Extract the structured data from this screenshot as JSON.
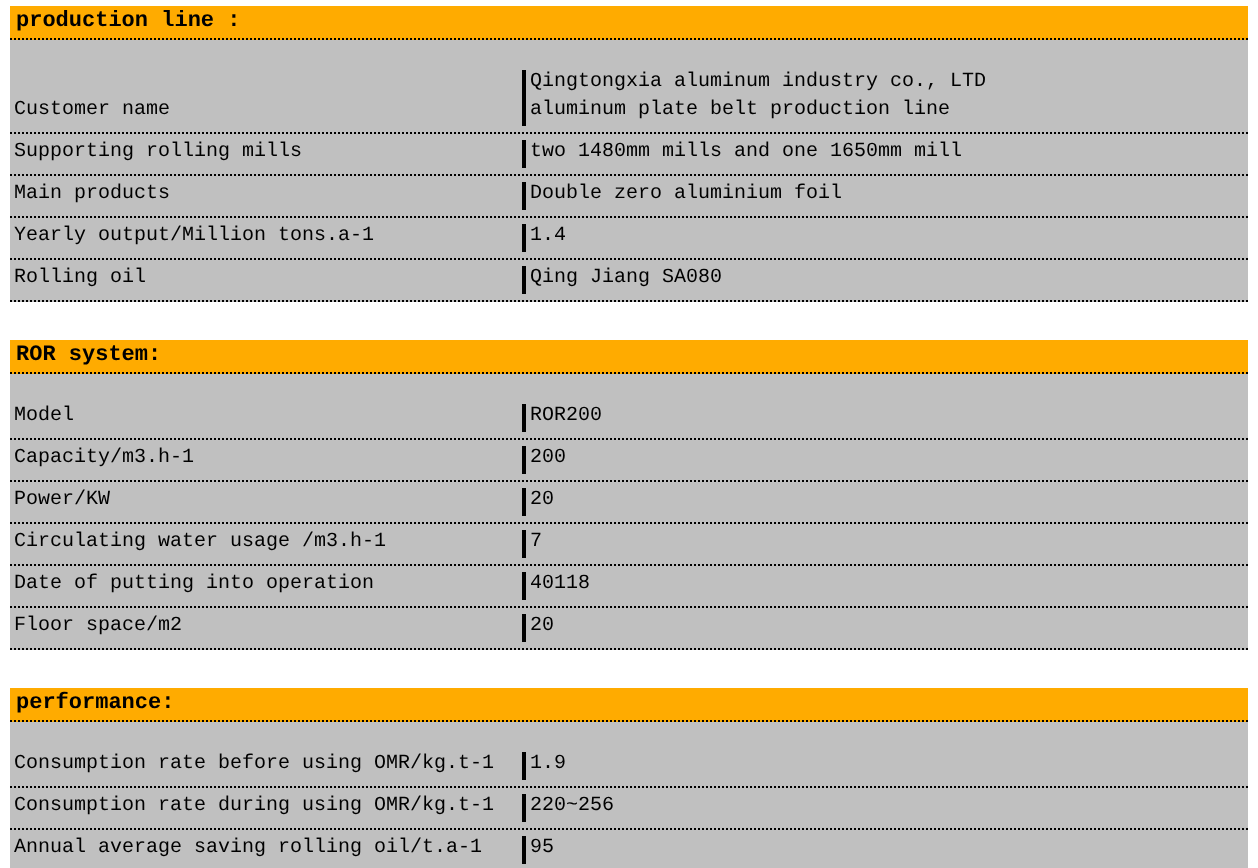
{
  "sections": [
    {
      "title": "production line :",
      "rows": [
        {
          "label": "Customer name",
          "value": [
            "Qingtongxia aluminum industry co., LTD",
            "aluminum plate belt production line"
          ]
        },
        {
          "label": "Supporting rolling mills",
          "value": [
            "two 1480mm mills and one 1650mm mill"
          ]
        },
        {
          "label": "Main products",
          "value": [
            "Double zero aluminium foil"
          ]
        },
        {
          "label": "Yearly output/Million tons.a-1",
          "value": [
            "1.4"
          ]
        },
        {
          "label": "Rolling oil",
          "value": [
            "Qing Jiang SA080"
          ]
        }
      ]
    },
    {
      "title": "ROR system:",
      "rows": [
        {
          "label": "Model",
          "value": [
            "ROR200"
          ]
        },
        {
          "label": "Capacity/m3.h-1",
          "value": [
            "200"
          ]
        },
        {
          "label": "Power/KW",
          "value": [
            "20"
          ]
        },
        {
          "label": "Circulating water usage /m3.h-1",
          "value": [
            "7"
          ]
        },
        {
          "label": "Date of putting into operation",
          "value": [
            "40118"
          ]
        },
        {
          "label": "Floor space/m2",
          "value": [
            "20"
          ]
        }
      ]
    },
    {
      "title": "performance:",
      "rows": [
        {
          "label": "Consumption rate before using OMR/kg.t-1",
          "value": [
            "1.9"
          ]
        },
        {
          "label": "Consumption rate during using OMR/kg.t-1",
          "value": [
            "220~256"
          ]
        },
        {
          "label": "Annual average saving rolling oil/t.a-1",
          "value": [
            "95"
          ]
        }
      ]
    }
  ]
}
